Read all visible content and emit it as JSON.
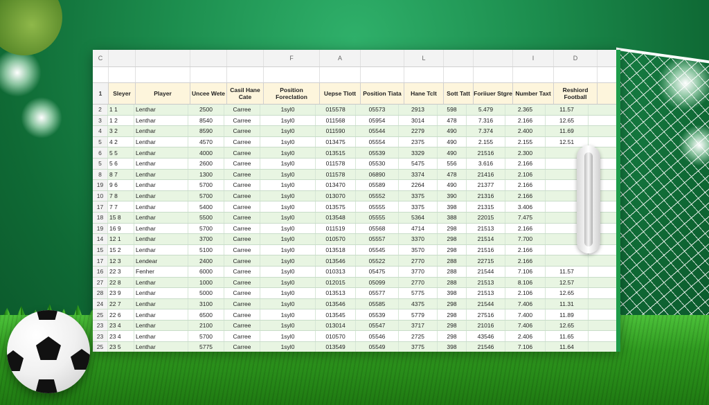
{
  "column_letters": [
    "C",
    "",
    "",
    "",
    "",
    "F",
    "A",
    "",
    "L",
    "",
    "",
    "I",
    "D"
  ],
  "headers": [
    "Sleyer",
    "Player",
    "Uncee Wete",
    "Casil Hane Cate",
    "Position Foreclation",
    "Uepse Tlott",
    "Position Tiata",
    "Hane Tclt",
    "Sott Tatt",
    "Foriiuer Stgre",
    "Number Taxt",
    "Reshiord Football"
  ],
  "header_row_number": "1",
  "rows": [
    [
      "2",
      "1 1",
      "Lenthar",
      "2500",
      "Carree",
      "1syl0",
      "015578",
      "05573",
      "2913",
      "598",
      "5.479",
      "2.365",
      "11.57"
    ],
    [
      "3",
      "1 2",
      "Lenthar",
      "8540",
      "Carree",
      "1syl0",
      "011568",
      "05954",
      "3014",
      "478",
      "7.316",
      "2.166",
      "12.65"
    ],
    [
      "4",
      "3 2",
      "Lenthar",
      "8590",
      "Carree",
      "1syl0",
      "011590",
      "05544",
      "2279",
      "490",
      "7.374",
      "2.400",
      "11.69"
    ],
    [
      "5",
      "4 2",
      "Lenthar",
      "4570",
      "Carree",
      "1syl0",
      "013475",
      "05554",
      "2375",
      "490",
      "2.155",
      "2.155",
      "12.51"
    ],
    [
      "6",
      "5 5",
      "Lenthar",
      "4000",
      "Carree",
      "1syl0",
      "013515",
      "05539",
      "3329",
      "490",
      "21516",
      "2.300",
      ""
    ],
    [
      "5",
      "5 6",
      "Lenthar",
      "2600",
      "Carree",
      "1syl0",
      "011578",
      "05530",
      "5475",
      "556",
      "3.616",
      "2.166",
      ""
    ],
    [
      "8",
      "8 7",
      "Lenthar",
      "1300",
      "Carree",
      "1syl0",
      "011578",
      "06890",
      "3374",
      "478",
      "21416",
      "2.106",
      ""
    ],
    [
      "19",
      "9 6",
      "Lenthar",
      "5700",
      "Carree",
      "1syl0",
      "013470",
      "05589",
      "2264",
      "490",
      "21377",
      "2.166",
      ""
    ],
    [
      "10",
      "7 8",
      "Lenthar",
      "5700",
      "Carree",
      "1syl0",
      "013070",
      "05552",
      "3375",
      "390",
      "21316",
      "2.166",
      ""
    ],
    [
      "17",
      "7 7",
      "Lenthar",
      "5400",
      "Carree",
      "1syl0",
      "013575",
      "05555",
      "3375",
      "398",
      "21315",
      "3.406",
      ""
    ],
    [
      "18",
      "15 8",
      "Lenthar",
      "5500",
      "Carree",
      "1syl0",
      "013548",
      "05555",
      "5364",
      "388",
      "22015",
      "7.475",
      ""
    ],
    [
      "19",
      "16 9",
      "Lenthar",
      "5700",
      "Carree",
      "1syl0",
      "011519",
      "05568",
      "4714",
      "298",
      "21513",
      "2.166",
      ""
    ],
    [
      "14",
      "12 1",
      "Lenthar",
      "3700",
      "Carree",
      "1syl0",
      "010570",
      "05557",
      "3370",
      "298",
      "21514",
      "7.700",
      ""
    ],
    [
      "15",
      "15 2",
      "Lenthar",
      "5100",
      "Carree",
      "1syl0",
      "013518",
      "05545",
      "3570",
      "298",
      "21516",
      "2.166",
      ""
    ],
    [
      "17",
      "12 3",
      "Lendear",
      "2400",
      "Carree",
      "1syl0",
      "013546",
      "05522",
      "2770",
      "288",
      "22715",
      "2.166",
      ""
    ],
    [
      "16",
      "22 3",
      "Fenher",
      "6000",
      "Carree",
      "1syl0",
      "010313",
      "05475",
      "3770",
      "288",
      "21544",
      "7.106",
      "11.57"
    ],
    [
      "27",
      "22 8",
      "Lenthar",
      "1000",
      "Carree",
      "1syl0",
      "012015",
      "05099",
      "2770",
      "288",
      "21513",
      "8.106",
      "12.57"
    ],
    [
      "28",
      "23 9",
      "Lenthar",
      "5000",
      "Carree",
      "1syl0",
      "013513",
      "05577",
      "5775",
      "398",
      "21513",
      "2.106",
      "12.65"
    ],
    [
      "24",
      "22 7",
      "Lenthar",
      "3100",
      "Carree",
      "1syl0",
      "013546",
      "05585",
      "4375",
      "298",
      "21544",
      "7.406",
      "11.31"
    ],
    [
      "25",
      "22 6",
      "Lenthar",
      "6500",
      "Carree",
      "1syl0",
      "013545",
      "05539",
      "5779",
      "298",
      "27516",
      "7.400",
      "11.89"
    ],
    [
      "23",
      "23 4",
      "Lenthar",
      "2100",
      "Carree",
      "1syl0",
      "013014",
      "05547",
      "3717",
      "298",
      "21016",
      "7.406",
      "12.65"
    ],
    [
      "23",
      "23 4",
      "Lenthar",
      "5700",
      "Carree",
      "1syl0",
      "010570",
      "05546",
      "2725",
      "298",
      "43546",
      "2.406",
      "11.65"
    ],
    [
      "25",
      "23 5",
      "Lenthar",
      "5775",
      "Carree",
      "1syl0",
      "013549",
      "05549",
      "3775",
      "398",
      "21546",
      "7.106",
      "11.64"
    ]
  ],
  "colors": {
    "accent": "#1e9c4a",
    "row_alt": "#e8f5e2",
    "header_bg": "#fdf5dc"
  }
}
